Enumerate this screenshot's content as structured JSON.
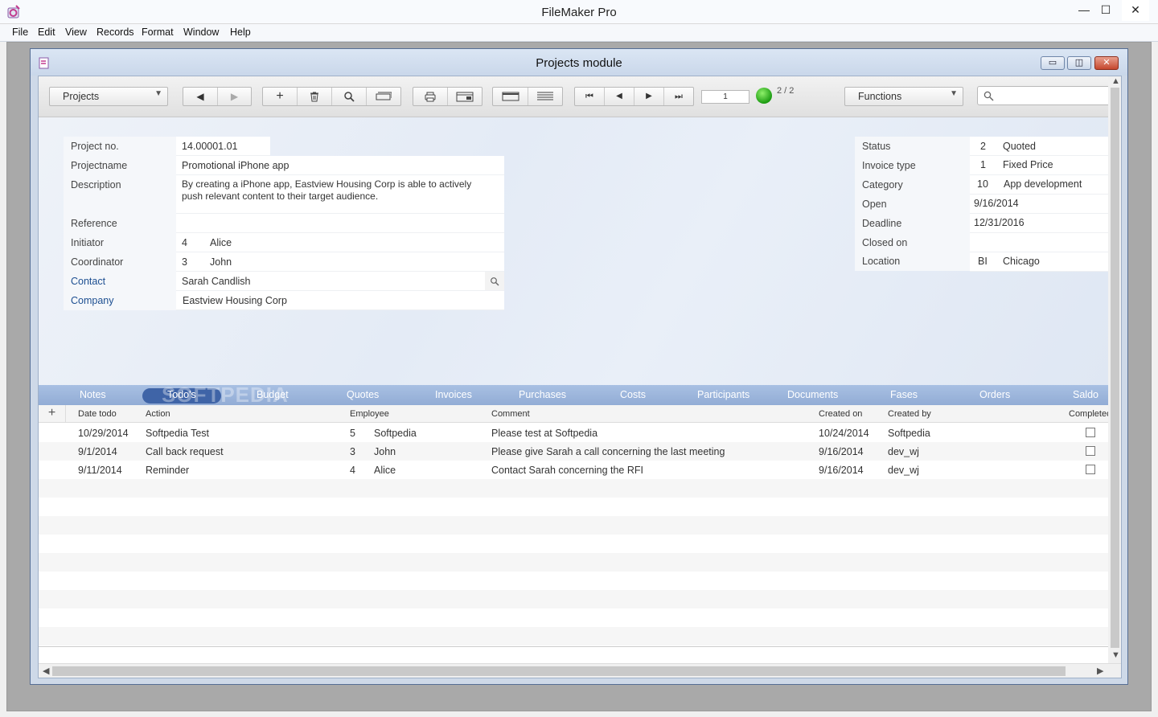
{
  "app": {
    "title": "FileMaker Pro",
    "minimize": "—",
    "maximize": "☐",
    "close": "✕"
  },
  "menu": [
    "File",
    "Edit",
    "View",
    "Records",
    "Format",
    "Window",
    "Help"
  ],
  "window": {
    "title": "Projects module",
    "minimize": "▭",
    "restore": "◫",
    "close": "✕"
  },
  "toolbar": {
    "layout_select": "Projects",
    "prev": "◀",
    "next": "▶",
    "new": "+",
    "delete": "🗑",
    "find": "⌕",
    "print": "⎙",
    "first": "⏮",
    "back": "◀",
    "forward": "▶",
    "last": "⏭",
    "record_number": "1",
    "record_count": "2 / 2",
    "functions_select": "Functions",
    "search_placeholder": ""
  },
  "project": {
    "project_no_label": "Project no.",
    "project_no": "14.00001.01",
    "projectname_label": "Projectname",
    "projectname": "Promotional iPhone app",
    "description_label": "Description",
    "description_line1": "By creating a iPhone app, Eastview Housing Corp is able to actively",
    "description_line2": "push relevant content to their target audience.",
    "reference_label": "Reference",
    "reference": "",
    "initiator_label": "Initiator",
    "initiator_id": "4",
    "initiator_name": "Alice",
    "coordinator_label": "Coordinator",
    "coordinator_id": "3",
    "coordinator_name": "John",
    "contact_label": "Contact",
    "contact": "Sarah Candlish",
    "company_label": "Company",
    "company": "Eastview Housing Corp"
  },
  "status_panel": {
    "status_label": "Status",
    "status_code": "2",
    "status": "Quoted",
    "invoice_type_label": "Invoice type",
    "invoice_type_code": "1",
    "invoice_type": "Fixed Price",
    "category_label": "Category",
    "category_code": "10",
    "category": "App development",
    "open_label": "Open",
    "open": "9/16/2014",
    "deadline_label": "Deadline",
    "deadline": "12/31/2016",
    "closed_label": "Closed on",
    "closed": "",
    "location_label": "Location",
    "location_code": "BI",
    "location": "Chicago"
  },
  "tabs": [
    "Notes",
    "Todo's",
    "Budget",
    "Quotes",
    "Invoices",
    "Purchases",
    "Costs",
    "Participants",
    "Documents",
    "Fases",
    "Orders",
    "Saldo"
  ],
  "watermark": "SOFTPEDIA",
  "portal": {
    "add": "+",
    "headers": {
      "date": "Date todo",
      "action": "Action",
      "employee": "Employee",
      "comment": "Comment",
      "created_on": "Created on",
      "created_by": "Created by",
      "completed": "Completed"
    },
    "rows": [
      {
        "date": "10/29/2014",
        "action": "Softpedia Test",
        "emp_id": "5",
        "emp_name": "Softpedia",
        "comment": "Please test at Softpedia",
        "created_on": "10/24/2014",
        "created_by": "Softpedia"
      },
      {
        "date": "9/1/2014",
        "action": "Call back request",
        "emp_id": "3",
        "emp_name": "John",
        "comment": "Please give Sarah a call concerning the last meeting",
        "created_on": "9/16/2014",
        "created_by": "dev_wj"
      },
      {
        "date": "9/11/2014",
        "action": "Reminder",
        "emp_id": "4",
        "emp_name": "Alice",
        "comment": "Contact Sarah concerning the RFI",
        "created_on": "9/16/2014",
        "created_by": "dev_wj"
      }
    ]
  },
  "colors": {
    "accent": "#1d4f91",
    "tabbar": "#9db6dc",
    "active_tab": "#3f64a7",
    "status_light": "#2fb51e"
  }
}
